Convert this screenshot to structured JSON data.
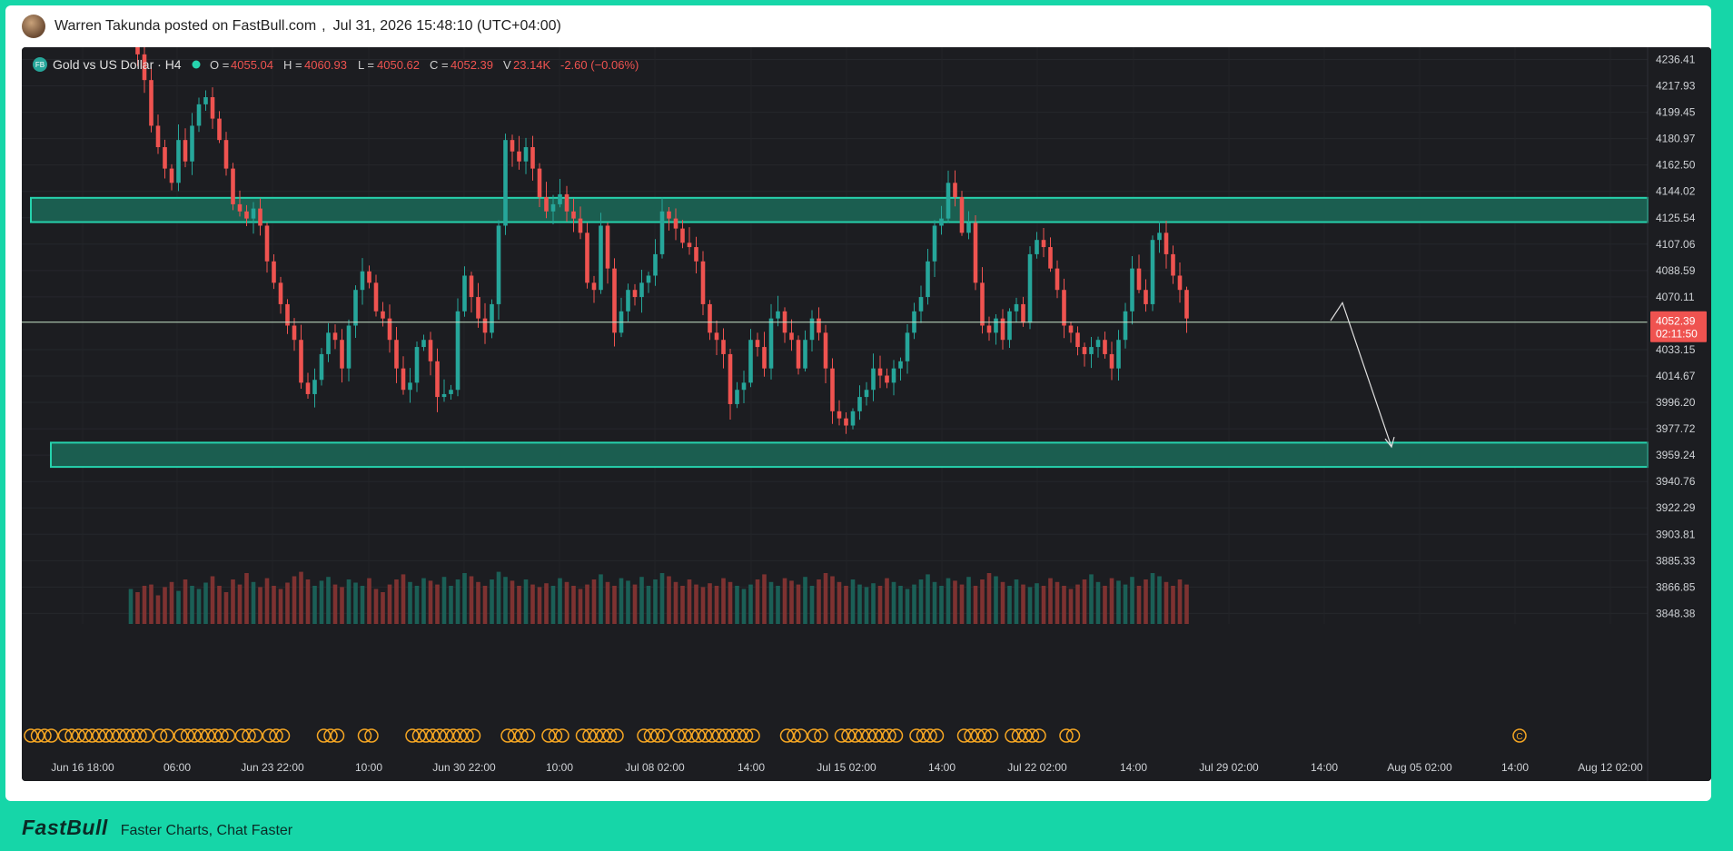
{
  "post": {
    "author_line": "Warren Takunda posted on FastBull.com",
    "timestamp": "Jul 31, 2026 15:48:10 (UTC+04:00)",
    "separator": ","
  },
  "footer": {
    "logo": "FastBull",
    "tagline": "Faster Charts, Chat Faster"
  },
  "legend": {
    "symbol": "Gold vs US Dollar · H4",
    "o_label": "O =",
    "o_value": "4055.04",
    "h_label": "H =",
    "h_value": "4060.93",
    "l_label": "L =",
    "l_value": "4050.62",
    "c_label": "C =",
    "c_value": "4052.39",
    "v_label": "V",
    "v_value": "23.14K",
    "change": "-2.60 (−0.06%)",
    "badge": "FB"
  },
  "colors": {
    "up": "#26a69a",
    "down": "#ef5350",
    "zone_fill": "#1b5e50",
    "zone_stroke": "#26d3ad",
    "price_line": "#c8e6c9",
    "event": "#f5a623",
    "background": "#1c1d21"
  },
  "chart_data": {
    "type": "candlestick",
    "title": "Gold vs US Dollar · H4",
    "y_ticks": [
      4236.41,
      4217.93,
      4199.45,
      4180.97,
      4162.5,
      4144.02,
      4125.54,
      4107.06,
      4088.59,
      4070.11,
      4033.15,
      4014.67,
      3996.2,
      3977.72,
      3959.24,
      3940.76,
      3922.29,
      3903.81,
      3885.33,
      3866.85,
      3848.38
    ],
    "ylim": [
      3841,
      4245
    ],
    "x_ticks": [
      "Jun 16 18:00",
      "06:00",
      "Jun 23 22:00",
      "10:00",
      "Jun 30 22:00",
      "10:00",
      "Jul 08 02:00",
      "14:00",
      "Jul 15 02:00",
      "14:00",
      "Jul 22 02:00",
      "14:00",
      "Jul 29 02:00",
      "14:00",
      "Aug 05 02:00",
      "14:00",
      "Aug 12 02:00"
    ],
    "current_price": "4052.39",
    "countdown": "02:11:50",
    "current_value": 4052.39,
    "zones": [
      {
        "name": "resistance",
        "from": 4122.5,
        "to": 4139.5
      },
      {
        "name": "support",
        "from": 3951.0,
        "to": 3968.0
      }
    ],
    "projection": [
      4053.5,
      4066.0,
      3965.0
    ],
    "closes": [
      4268,
      4240,
      4222,
      4190,
      4175,
      4160,
      4150,
      4180,
      4165,
      4190,
      4205,
      4210,
      4195,
      4180,
      4160,
      4135,
      4130,
      4125,
      4132,
      4120,
      4095,
      4080,
      4065,
      4050,
      4040,
      4010,
      4002,
      4012,
      4030,
      4045,
      4040,
      4020,
      4050,
      4075,
      4088,
      4080,
      4060,
      4055,
      4040,
      4020,
      4005,
      4010,
      4035,
      4040,
      4025,
      4000,
      4002,
      4005,
      4060,
      4085,
      4070,
      4055,
      4045,
      4065,
      4120,
      4180,
      4172,
      4165,
      4175,
      4160,
      4140,
      4130,
      4135,
      4142,
      4130,
      4125,
      4115,
      4080,
      4075,
      4120,
      4090,
      4045,
      4060,
      4075,
      4070,
      4080,
      4085,
      4100,
      4130,
      4125,
      4118,
      4108,
      4105,
      4095,
      4065,
      4045,
      4040,
      4030,
      3995,
      4005,
      4010,
      4040,
      4035,
      4020,
      4055,
      4060,
      4045,
      4040,
      4020,
      4040,
      4055,
      4045,
      4020,
      3990,
      3985,
      3980,
      3990,
      4000,
      4005,
      4020,
      4015,
      4010,
      4020,
      4025,
      4045,
      4060,
      4070,
      4095,
      4120,
      4125,
      4150,
      4140,
      4115,
      4122,
      4080,
      4050,
      4045,
      4055,
      4040,
      4060,
      4065,
      4052,
      4100,
      4110,
      4105,
      4090,
      4075,
      4050,
      4045,
      4035,
      4030,
      4035,
      4040,
      4030,
      4020,
      4040,
      4060,
      4090,
      4075,
      4065,
      4110,
      4115,
      4100,
      4085,
      4075,
      4055
    ],
    "volumes": [
      0.55,
      0.5,
      0.6,
      0.62,
      0.45,
      0.58,
      0.66,
      0.52,
      0.7,
      0.6,
      0.55,
      0.65,
      0.75,
      0.6,
      0.5,
      0.7,
      0.62,
      0.8,
      0.66,
      0.58,
      0.72,
      0.6,
      0.55,
      0.65,
      0.75,
      0.82,
      0.7,
      0.6,
      0.68,
      0.74,
      0.62,
      0.58,
      0.7,
      0.65,
      0.6,
      0.72,
      0.55,
      0.5,
      0.62,
      0.7,
      0.78,
      0.66,
      0.6,
      0.72,
      0.68,
      0.62,
      0.74,
      0.6,
      0.7,
      0.8,
      0.75,
      0.66,
      0.6,
      0.7,
      0.82,
      0.74,
      0.68,
      0.6,
      0.7,
      0.62,
      0.58,
      0.64,
      0.6,
      0.72,
      0.66,
      0.6,
      0.55,
      0.62,
      0.7,
      0.78,
      0.66,
      0.6,
      0.72,
      0.68,
      0.62,
      0.74,
      0.6,
      0.7,
      0.8,
      0.75,
      0.66,
      0.6,
      0.7,
      0.62,
      0.58,
      0.64,
      0.6,
      0.72,
      0.66,
      0.6,
      0.55,
      0.62,
      0.7,
      0.78,
      0.66,
      0.6,
      0.72,
      0.68,
      0.62,
      0.74,
      0.6,
      0.7,
      0.8,
      0.75,
      0.66,
      0.6,
      0.7,
      0.62,
      0.58,
      0.64,
      0.6,
      0.72,
      0.66,
      0.6,
      0.55,
      0.62,
      0.7,
      0.78,
      0.66,
      0.6,
      0.72,
      0.68,
      0.62,
      0.74,
      0.6,
      0.7,
      0.8,
      0.75,
      0.66,
      0.6,
      0.7,
      0.62,
      0.58,
      0.64,
      0.6,
      0.72,
      0.66,
      0.6,
      0.55,
      0.62,
      0.7,
      0.78,
      0.66,
      0.6,
      0.72,
      0.68,
      0.62,
      0.74,
      0.6,
      0.7,
      0.8,
      0.75,
      0.66,
      0.6,
      0.7,
      0.62,
      0.58,
      0.64,
      0.6,
      0.72
    ],
    "event_marker": "C",
    "event_groups": [
      [
        0,
        3
      ],
      [
        5,
        17
      ],
      [
        19,
        20
      ],
      [
        22,
        29
      ],
      [
        31,
        33
      ],
      [
        35,
        37
      ],
      [
        43,
        45
      ],
      [
        49,
        50
      ],
      [
        56,
        65
      ],
      [
        70,
        73
      ],
      [
        76,
        78
      ],
      [
        81,
        86
      ],
      [
        90,
        93
      ],
      [
        95,
        106
      ],
      [
        111,
        113
      ],
      [
        115,
        116
      ],
      [
        119,
        127
      ],
      [
        130,
        133
      ],
      [
        137,
        141
      ],
      [
        144,
        148
      ],
      [
        152,
        153
      ]
    ],
    "future_event": true
  }
}
